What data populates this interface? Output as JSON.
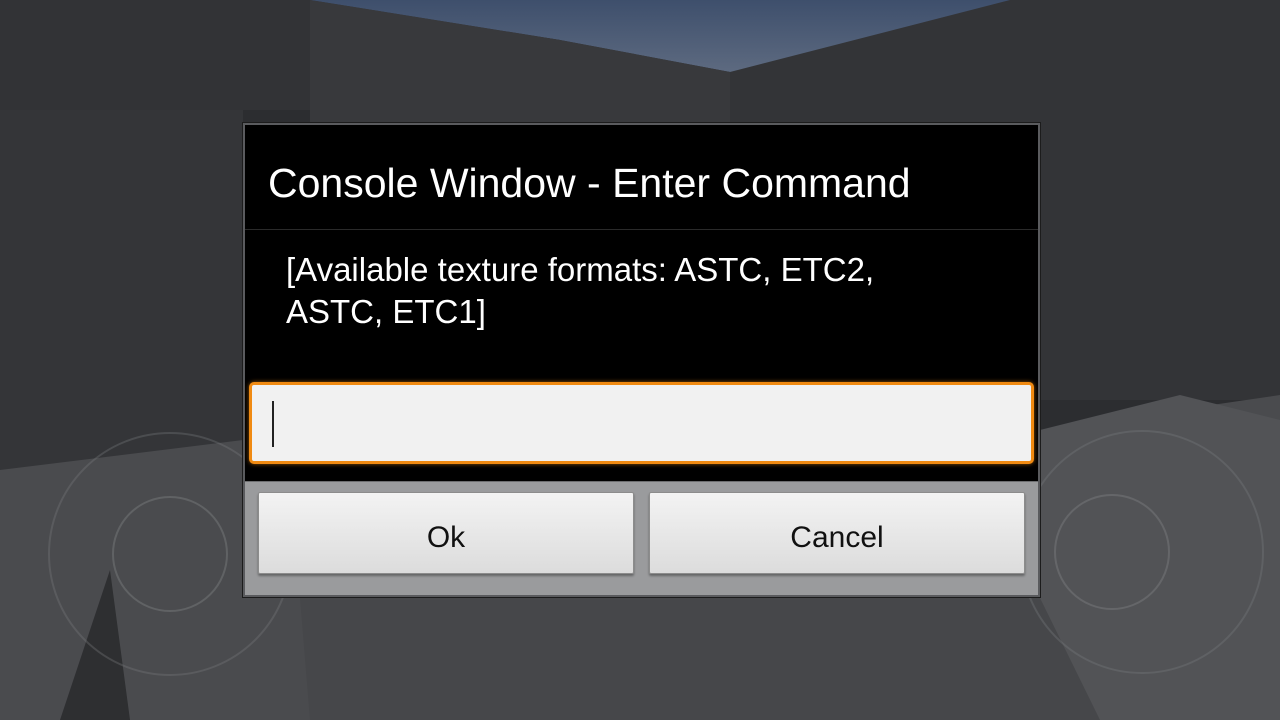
{
  "dialog": {
    "title": "Console Window - Enter Command",
    "message": "[Available texture formats: ASTC, ETC2, ASTC, ETC1]",
    "input": {
      "value": "",
      "placeholder": ""
    },
    "buttons": {
      "ok_label": "Ok",
      "cancel_label": "Cancel"
    }
  },
  "colors": {
    "focus_accent": "#f08a12",
    "dialog_background": "#000000",
    "button_bar": "#9a9b9d"
  },
  "icons": {
    "left_control": "virtual-joystick-icon",
    "right_control": "virtual-joystick-icon"
  }
}
